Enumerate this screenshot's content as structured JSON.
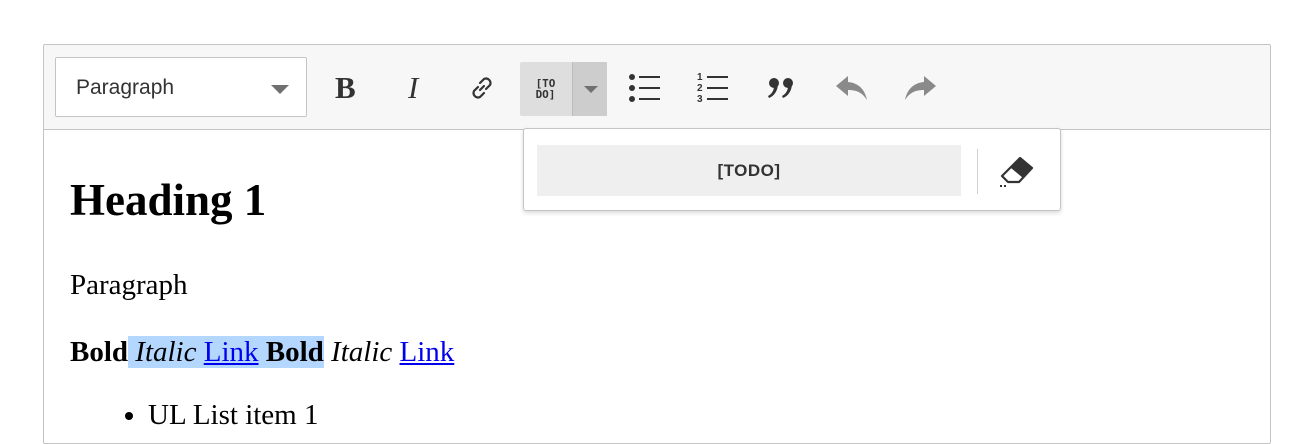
{
  "toolbar": {
    "heading_dropdown": {
      "value": "Paragraph"
    },
    "buttons": [
      {
        "name": "bold",
        "icon": "bold-icon"
      },
      {
        "name": "italic",
        "icon": "italic-icon"
      },
      {
        "name": "link",
        "icon": "link-icon"
      },
      {
        "name": "todo",
        "icon": "todo-icon",
        "label": "[TO\nDO]"
      },
      {
        "name": "bulleted-list",
        "icon": "bulleted-list-icon"
      },
      {
        "name": "numbered-list",
        "icon": "numbered-list-icon"
      },
      {
        "name": "blockquote",
        "icon": "quote-icon"
      },
      {
        "name": "undo",
        "icon": "undo-icon"
      },
      {
        "name": "redo",
        "icon": "redo-icon"
      }
    ]
  },
  "dropdown": {
    "todo_label": "[TODO]",
    "eraser_icon": "eraser-icon"
  },
  "content": {
    "heading": "Heading 1",
    "paragraph": "Paragraph",
    "formatted": {
      "bold1": "Bold",
      "italic1": "Italic",
      "link1": "Link",
      "bold2": "Bold",
      "italic2": "Italic",
      "link2": "Link"
    },
    "list_items": [
      "UL List item 1"
    ]
  },
  "colors": {
    "selection": "#b4d7ff",
    "link": "#0000ee",
    "toolbar_bg": "#f7f7f7",
    "active_button": "#dedede"
  }
}
